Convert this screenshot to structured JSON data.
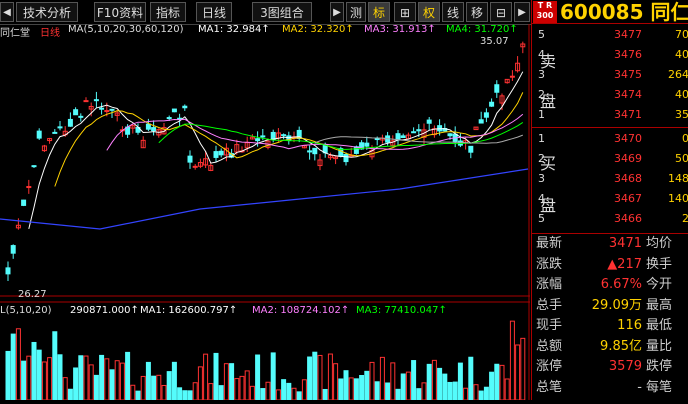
{
  "toolbar": {
    "items": [
      "技术分析",
      "F10资料",
      "指标",
      "日线",
      "3图组合",
      "测",
      "标",
      "⊞",
      "权",
      "线",
      "移",
      "⊟"
    ],
    "selected": "标"
  },
  "stock": {
    "code": "600085",
    "name": "同仁堂",
    "badge_top": "T R",
    "badge_bottom": "300"
  },
  "chart_header": {
    "name": "同仁堂",
    "period": "日线",
    "ma_label": "MA(5,10,20,30,60,120)",
    "ma1": "MA1: 32.984↑",
    "ma2": "MA2: 32.320↑",
    "ma3": "MA3: 31.913↑",
    "ma4": "MA4: 31.720↑",
    "high_label": "35.07",
    "low_label": "26.27"
  },
  "volume_header": {
    "label": "L(5,10,20)",
    "vol": "290871.000↑",
    "ma1": "MA1: 162600.797↑",
    "ma2": "MA2: 108724.102↑",
    "ma3": "MA3: 77410.047↑"
  },
  "order_book": {
    "sell_label_1": "卖",
    "sell_label_2": "盘",
    "buy_label_1": "买",
    "buy_label_2": "盘",
    "sells": [
      {
        "idx": "5",
        "price": "3477",
        "vol": "70"
      },
      {
        "idx": "4",
        "price": "3476",
        "vol": "40"
      },
      {
        "idx": "3",
        "price": "3475",
        "vol": "264"
      },
      {
        "idx": "2",
        "price": "3474",
        "vol": "40"
      },
      {
        "idx": "1",
        "price": "3471",
        "vol": "35"
      }
    ],
    "buys": [
      {
        "idx": "1",
        "price": "3470",
        "vol": "0"
      },
      {
        "idx": "2",
        "price": "3469",
        "vol": "50"
      },
      {
        "idx": "3",
        "price": "3468",
        "vol": "148"
      },
      {
        "idx": "4",
        "price": "3467",
        "vol": "140"
      },
      {
        "idx": "5",
        "price": "3466",
        "vol": "2"
      }
    ]
  },
  "quote": [
    {
      "label": "最新",
      "value": "3471",
      "label2": "均价",
      "color": "#ff3232"
    },
    {
      "label": "涨跌",
      "value": "▲217",
      "label2": "换手",
      "color": "#ff3232"
    },
    {
      "label": "涨幅",
      "value": "6.67%",
      "label2": "今开",
      "color": "#ff3232"
    },
    {
      "label": "总手",
      "value": "29.09万",
      "label2": "最高",
      "color": "#ffd200"
    },
    {
      "label": "现手",
      "value": "116",
      "label2": "最低",
      "color": "#ffd200"
    },
    {
      "label": "总额",
      "value": "9.85亿",
      "label2": "量比",
      "color": "#ffd200"
    },
    {
      "label": "涨停",
      "value": "3579",
      "label2": "跌停",
      "color": "#ff3232"
    },
    {
      "label": "总笔",
      "value": "-",
      "label2": "每笔",
      "color": "#ccc"
    }
  ],
  "colors": {
    "up": "#ff3232",
    "down": "#54fcfc",
    "ma5": "#ffffff",
    "ma10": "#ffd200",
    "ma20": "#ff80ff",
    "ma30": "#00ff00",
    "ma60": "#aaaaaa",
    "ma120": "#3344ff"
  }
}
